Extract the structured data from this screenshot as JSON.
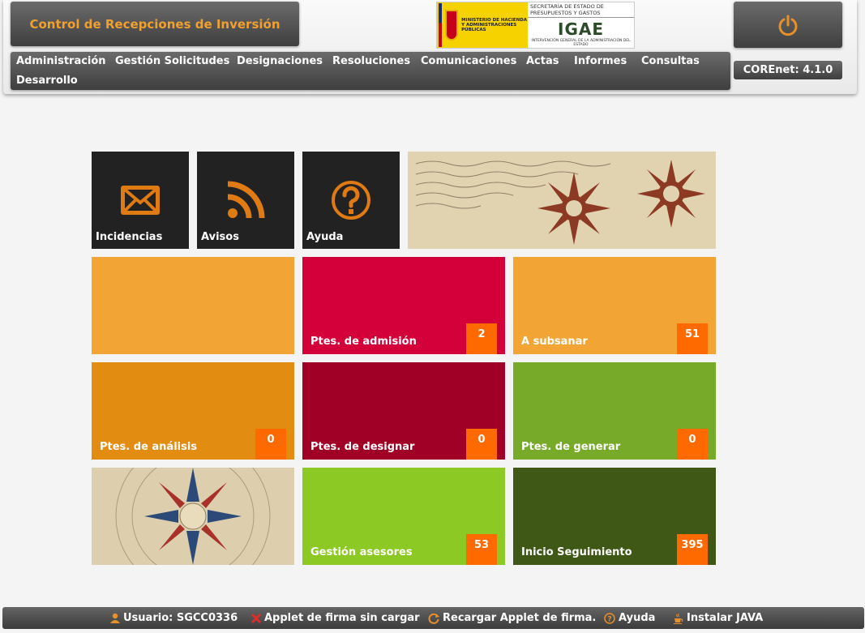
{
  "app": {
    "title": "Control de Recepciones de Inversión",
    "version": "COREnet: 4.1.0"
  },
  "logo": {
    "ministry_text": "MINISTERIO DE HACIENDA Y ADMINISTRACIONES PÚBLICAS",
    "secretaria_text": "SECRETARÍA DE ESTADO DE PRESUPUESTOS Y GASTOS",
    "igae_mark": "IGAE",
    "igae_sub": "INTERVENCIÓN GENERAL DE LA ADMINISTRACIÓN DEL ESTADO"
  },
  "menu": {
    "items": [
      "Administración",
      "Gestión Solicitudes",
      "Designaciones",
      "Resoluciones",
      "Comunicaciones",
      "Actas",
      "Informes",
      "Consultas",
      "Desarrollo"
    ]
  },
  "top_tiles": {
    "incidencias": {
      "label": "Incidencias",
      "icon": "envelope-icon"
    },
    "avisos": {
      "label": "Avisos",
      "icon": "rss-icon"
    },
    "ayuda": {
      "label": "Ayuda",
      "icon": "question-icon"
    }
  },
  "tiles": {
    "ptes_admision": {
      "label": "Ptes. de admisión",
      "count": "2",
      "color": "#d4003a"
    },
    "a_subsanar": {
      "label": "A subsanar",
      "count": "51",
      "color": "#f2a535"
    },
    "ptes_analisis": {
      "label": "Ptes. de análisis",
      "count": "0",
      "color": "#e38c12"
    },
    "ptes_designar": {
      "label": "Ptes. de designar",
      "count": "0",
      "color": "#a00025"
    },
    "ptes_generar": {
      "label": "Ptes. de generar",
      "count": "0",
      "color": "#78aa2a"
    },
    "gestion_asesores": {
      "label": "Gestión asesores",
      "count": "53",
      "color": "#8cc925"
    },
    "inicio_seguimiento": {
      "label": "Inicio Seguimiento",
      "count": "395",
      "color": "#3f5816"
    }
  },
  "footer": {
    "usuario": "Usuario: SGCC0336",
    "applet_status": "Applet de firma sin cargar",
    "recargar": "Recargar Applet de firma.",
    "ayuda": "Ayuda",
    "instalar_java": "Instalar JAVA"
  },
  "colors": {
    "accent": "#f0a030",
    "count_badge": "#ff6a00",
    "dark_tile": "#222222"
  }
}
